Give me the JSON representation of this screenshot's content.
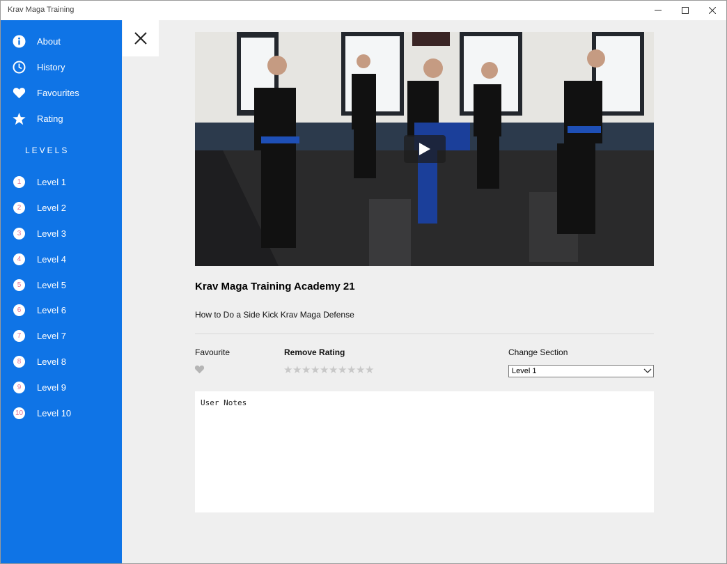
{
  "window": {
    "title": "Krav Maga Training",
    "controls": {
      "minimize": "minimize-icon",
      "maximize": "maximize-icon",
      "close": "close-icon"
    }
  },
  "sidebar": {
    "bg_color": "#0f74e6",
    "menu": [
      {
        "label": "About",
        "icon": "info-icon"
      },
      {
        "label": "History",
        "icon": "clock-icon"
      },
      {
        "label": "Favourites",
        "icon": "heart-icon"
      },
      {
        "label": "Rating",
        "icon": "star-icon"
      }
    ],
    "levels_heading": "LEVELS",
    "levels": [
      {
        "num": "1",
        "label": "Level 1"
      },
      {
        "num": "2",
        "label": "Level 2"
      },
      {
        "num": "3",
        "label": "Level 3"
      },
      {
        "num": "4",
        "label": "Level 4"
      },
      {
        "num": "5",
        "label": "Level 5"
      },
      {
        "num": "6",
        "label": "Level 6"
      },
      {
        "num": "7",
        "label": "Level 7"
      },
      {
        "num": "8",
        "label": "Level 8"
      },
      {
        "num": "9",
        "label": "Level 9"
      },
      {
        "num": "10",
        "label": "Level 10"
      }
    ]
  },
  "detail": {
    "close_icon": "close-x-icon",
    "video": {
      "thumbnail": "krav-maga-side-kick-class-photo",
      "play_icon": "play-icon"
    },
    "title": "Krav Maga Training Academy 21",
    "description": "How to Do a Side Kick Krav Maga Defense",
    "favourite_label": "Favourite",
    "favourite_icon": "heart-icon",
    "rating_label": "Remove Rating",
    "rating": {
      "value": 0,
      "max": 10
    },
    "section_label": "Change Section",
    "section_value": "Level 1",
    "notes_placeholder": "User Notes"
  }
}
